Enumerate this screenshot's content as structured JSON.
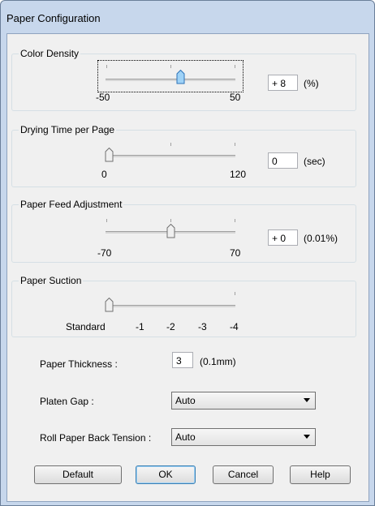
{
  "window": {
    "title": "Paper Configuration"
  },
  "color_density": {
    "label": "Color Density",
    "min_label": "-50",
    "max_label": "50",
    "value": "+ 8",
    "unit": "(%)",
    "slider_value": 8
  },
  "drying_time": {
    "label": "Drying Time per Page",
    "min_label": "0",
    "max_label": "120",
    "value": "0",
    "unit": "(sec)",
    "slider_value": 0
  },
  "paper_feed": {
    "label": "Paper Feed Adjustment",
    "min_label": "-70",
    "max_label": "70",
    "value": "+ 0",
    "unit": "(0.01%)",
    "slider_value": 0
  },
  "paper_suction": {
    "label": "Paper Suction",
    "scale_labels": [
      "Standard",
      "-1",
      "-2",
      "-3",
      "-4"
    ],
    "slider_value": "Standard"
  },
  "paper_thickness": {
    "label": "Paper Thickness :",
    "value": "3",
    "unit": "(0.1mm)"
  },
  "platen_gap": {
    "label": "Platen Gap :",
    "value": "Auto"
  },
  "roll_tension": {
    "label": "Roll Paper Back Tension :",
    "value": "Auto"
  },
  "buttons": {
    "default": "Default",
    "ok": "OK",
    "cancel": "Cancel",
    "help": "Help"
  }
}
